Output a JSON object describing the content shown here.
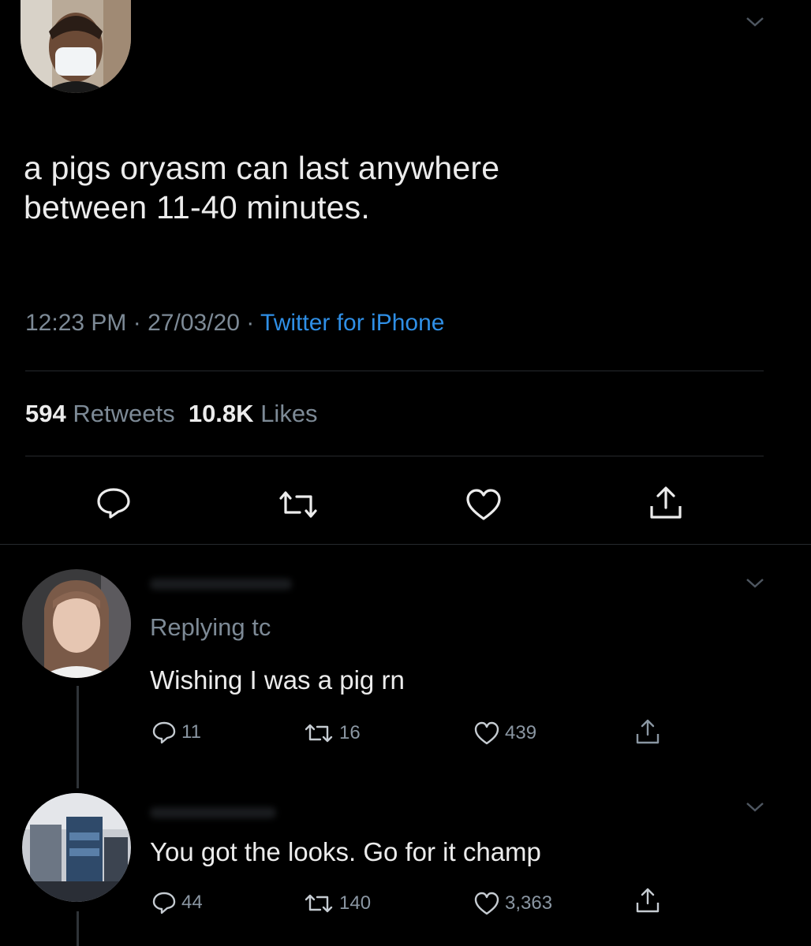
{
  "tweet": {
    "avatar": "user-avatar-masked",
    "text_line1": "a pigs oryasm can last anywhere",
    "text_line2": "between 11-40 minutes.",
    "time": "12:23 PM",
    "sep": "·",
    "date": "27/03/20",
    "source": "Twitter for iPhone",
    "retweets_count": "594",
    "retweets_label": "Retweets",
    "likes_count": "10.8K",
    "likes_label": "Likes",
    "actions": [
      "reply-icon",
      "retweet-icon",
      "like-icon",
      "share-icon"
    ]
  },
  "replies": [
    {
      "replying_to": "Replying tc",
      "text": "Wishing I was a pig rn",
      "reply_count": "11",
      "retweet_count": "16",
      "like_count": "439"
    },
    {
      "text": "You got the looks. Go for it champ",
      "reply_count": "44",
      "retweet_count": "140",
      "like_count": "3,363"
    }
  ],
  "colors": {
    "background": "#000000",
    "text": "#ececec",
    "muted": "#7d8a96",
    "link": "#2f8fe6"
  }
}
